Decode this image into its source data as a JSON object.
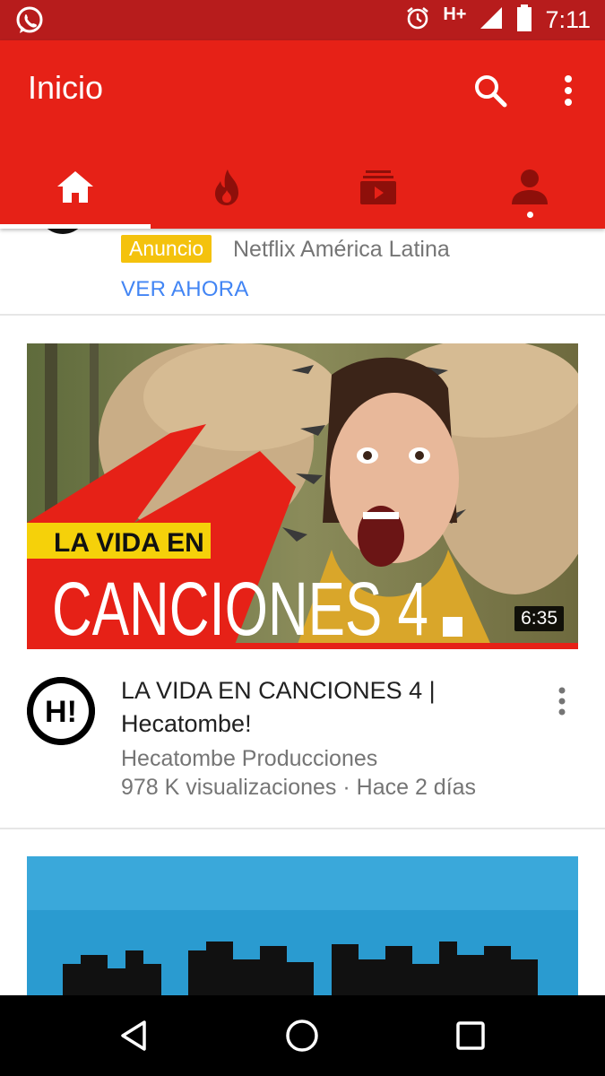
{
  "status_bar": {
    "left_icon": "whatsapp-icon",
    "network": "H+",
    "time": "7:11",
    "icons": [
      "alarm-icon",
      "signal-icon",
      "battery-icon"
    ]
  },
  "app_bar": {
    "title": "Inicio",
    "actions": [
      "search-icon",
      "more-vert-icon"
    ],
    "tabs": [
      {
        "icon": "home-icon",
        "selected": true
      },
      {
        "icon": "trending-icon",
        "selected": false
      },
      {
        "icon": "subscriptions-icon",
        "selected": false
      },
      {
        "icon": "account-icon",
        "selected": false,
        "has_dot": true
      }
    ]
  },
  "ad": {
    "badge": "Anuncio",
    "channel": "Netflix América Latina",
    "cta": "VER AHORA"
  },
  "video": {
    "thumbnail_text_line1": "LA VIDA EN",
    "thumbnail_text_line2": "CANCIONES 4",
    "duration": "6:35",
    "avatar_text": "H!",
    "title": "LA VIDA EN CANCIONES 4 | Hecatombe!",
    "channel": "Hecatombe Producciones",
    "meta": "978 K visualizaciones · Hace 2 días",
    "colors": {
      "accent": "#e62117",
      "banner_yellow": "#f5d10a"
    }
  },
  "nav_bar": {
    "buttons": [
      "back-icon",
      "home-circle-icon",
      "recents-icon"
    ]
  }
}
